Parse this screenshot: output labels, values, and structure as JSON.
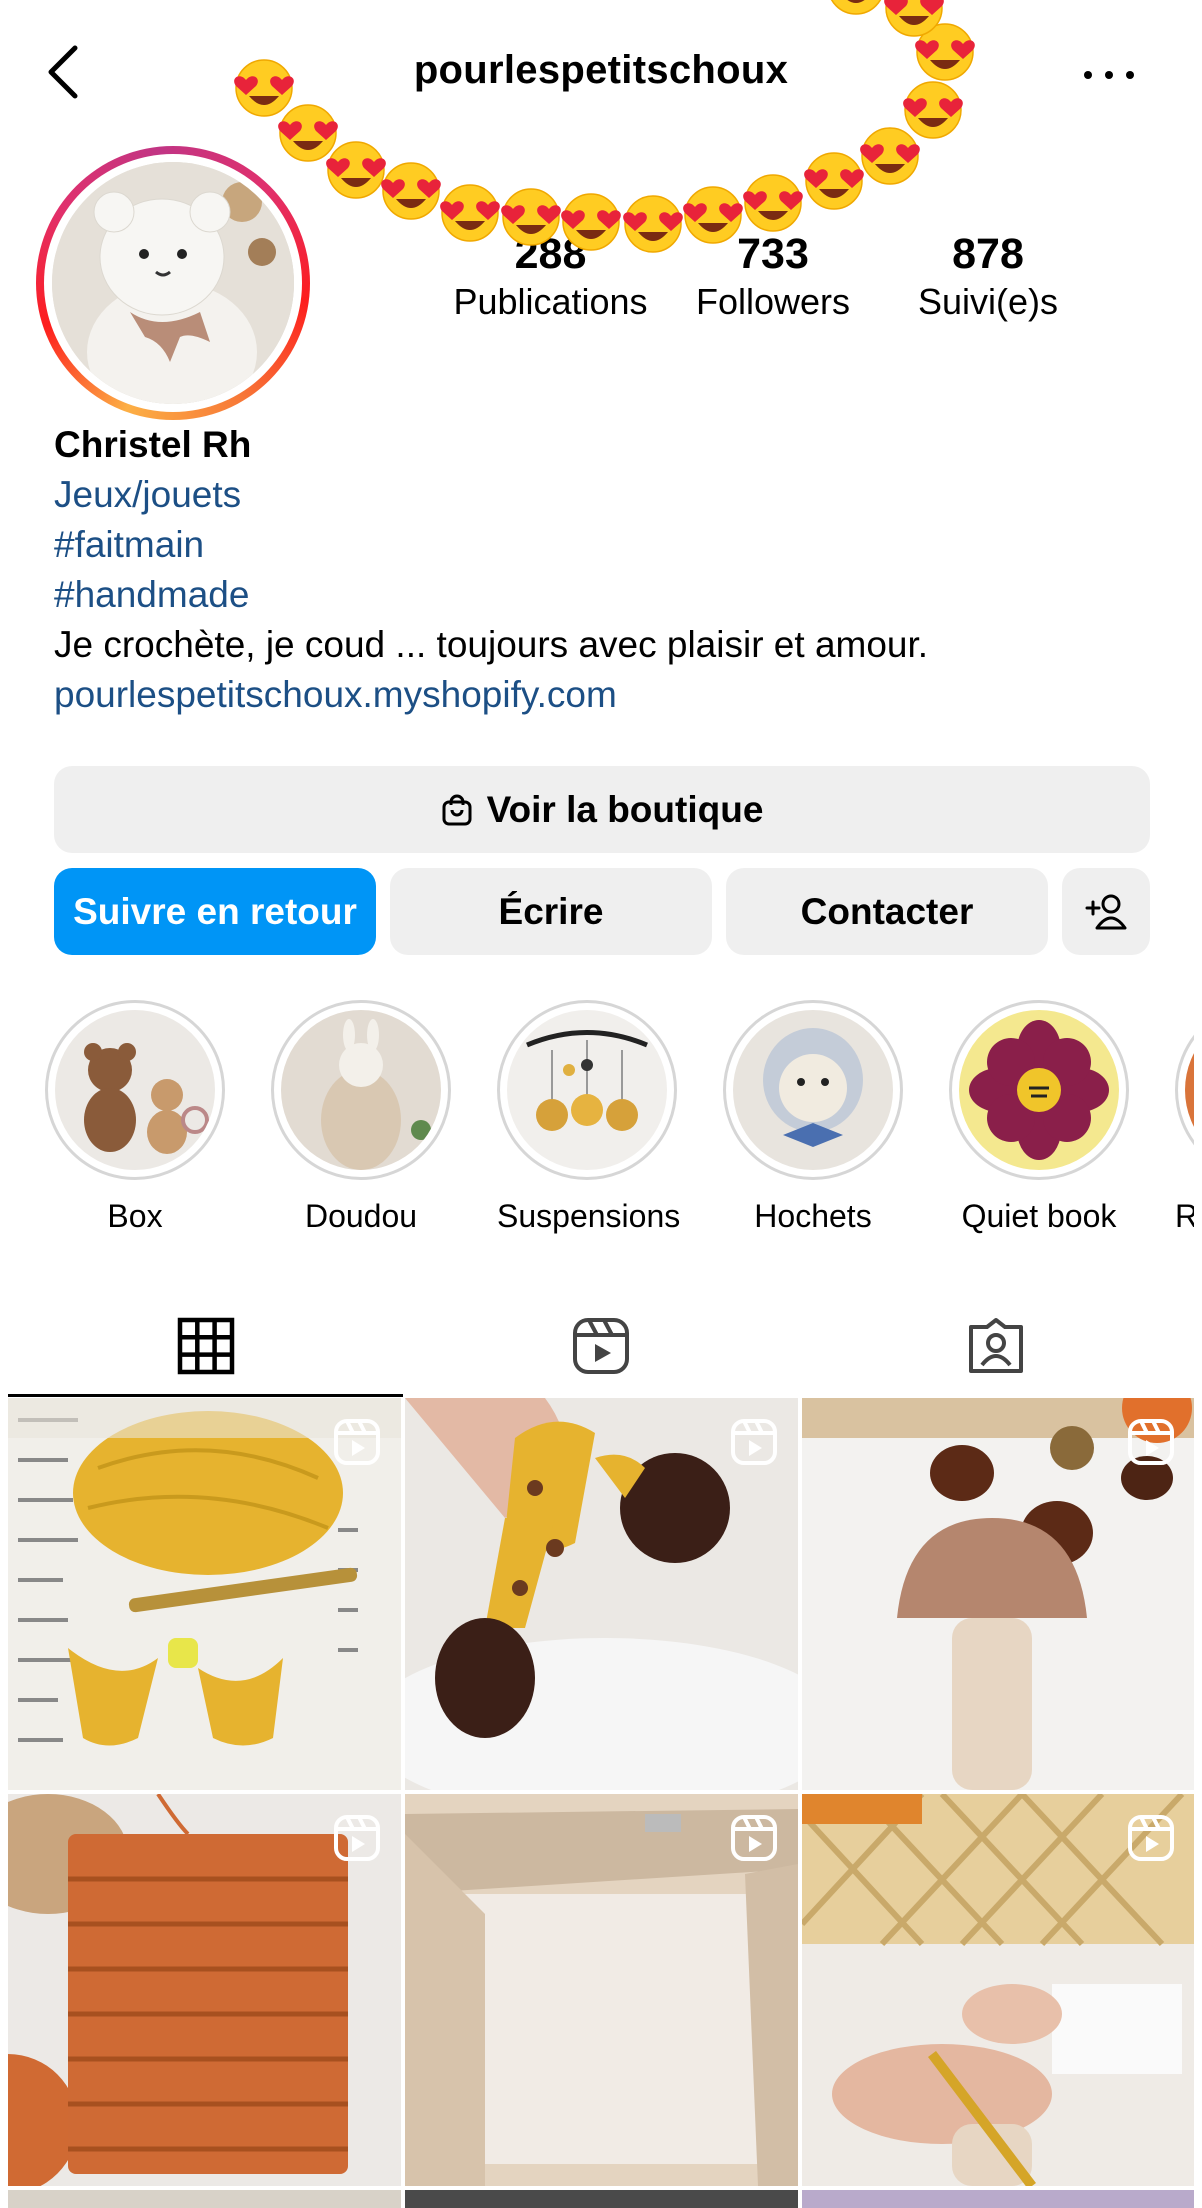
{
  "header": {
    "username": "pourlespetitschoux",
    "back_icon": "chevron-left-icon",
    "more_icon": "more-horizontal-icon"
  },
  "profile": {
    "avatar_alt": "crochet bear doll",
    "stats": [
      {
        "value": "288",
        "label": "Publications"
      },
      {
        "value": "733",
        "label": "Followers"
      },
      {
        "value": "878",
        "label": "Suivi(e)s"
      }
    ],
    "name": "Christel Rh",
    "category": "Jeux/jouets",
    "hashtags": [
      "#faitmain",
      "#handmade"
    ],
    "bio_text": "Je crochète, je coud ... toujours avec plaisir et amour.",
    "website": "pourlespetitschoux.myshopify.com"
  },
  "actions": {
    "shop_label": "Voir la boutique",
    "follow_back_label": "Suivre en retour",
    "message_label": "Écrire",
    "contact_label": "Contacter",
    "add_user_icon": "add-person-icon"
  },
  "highlights": [
    {
      "label": "Box"
    },
    {
      "label": "Doudou"
    },
    {
      "label": "Suspensions"
    },
    {
      "label": "Hochets"
    },
    {
      "label": "Quiet book"
    },
    {
      "label": "R"
    }
  ],
  "tabs": [
    {
      "icon": "grid-icon",
      "active": true
    },
    {
      "icon": "reels-icon",
      "active": false
    },
    {
      "icon": "tagged-icon",
      "active": false
    }
  ],
  "colors": {
    "primary_button": "#0095f6",
    "link": "#1c4f85",
    "secondary_button": "#efefef"
  },
  "posts": [
    {
      "type": "reel",
      "subject": "yellow yarn and crochet pieces"
    },
    {
      "type": "reel",
      "subject": "crochet giraffe legs"
    },
    {
      "type": "reel",
      "subject": "crochet mushroom"
    },
    {
      "type": "reel",
      "subject": "orange crochet panel"
    },
    {
      "type": "reel",
      "subject": "wooden box"
    },
    {
      "type": "reel",
      "subject": "crocheting hands"
    }
  ]
}
